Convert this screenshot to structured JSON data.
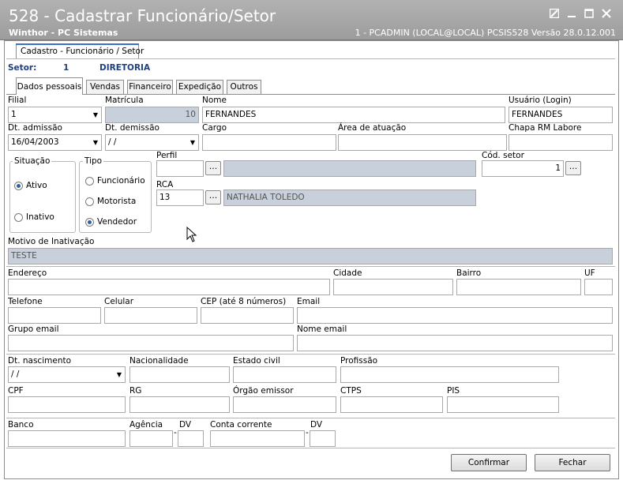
{
  "window": {
    "title": "528 - Cadastrar Funcionário/Setor",
    "company": "Winthor - PC Sistemas",
    "info": "1 - PCADMIN (LOCAL@LOCAL)   PCSIS528  Versão  28.0.12.001",
    "controls": [
      "restore-icon",
      "minimize-icon",
      "maximize-icon",
      "close-icon"
    ]
  },
  "outer_tab": "Cadastro - Funcionário / Setor",
  "setor": {
    "label": "Setor:",
    "code": "1",
    "name": "DIRETORIA"
  },
  "tabs": [
    "Dados pessoais",
    "Vendas",
    "Financeiro",
    "Expedição",
    "Outros"
  ],
  "fields": {
    "filial": {
      "label": "Filial",
      "value": "1"
    },
    "matricula": {
      "label": "Matrícula",
      "value": "10"
    },
    "nome": {
      "label": "Nome",
      "value": "FERNANDES"
    },
    "usuario": {
      "label": "Usuário (Login)",
      "value": "FERNANDES"
    },
    "dt_admissao": {
      "label": "Dt. admissão",
      "value": "16/04/2003"
    },
    "dt_demissao": {
      "label": "Dt.  demissão",
      "value": " / /"
    },
    "cargo": {
      "label": "Cargo",
      "value": ""
    },
    "area": {
      "label": "Área de atuação",
      "value": ""
    },
    "chapa": {
      "label": "Chapa RM Labore",
      "value": ""
    },
    "perfil": {
      "label": "Perfil",
      "value": ""
    },
    "cod_setor": {
      "label": "Cód. setor",
      "value": "1"
    },
    "rca": {
      "label": "RCA",
      "value": "13",
      "desc": "NATHALIA TOLEDO"
    },
    "motivo": {
      "label": "Motivo de Inativação",
      "value": "TESTE"
    },
    "endereco": {
      "label": "Endereço"
    },
    "cidade": {
      "label": "Cidade"
    },
    "bairro": {
      "label": "Bairro"
    },
    "uf": {
      "label": "UF"
    },
    "telefone": {
      "label": "Telefone"
    },
    "celular": {
      "label": "Celular"
    },
    "cep": {
      "label": "CEP (até 8 números)"
    },
    "email": {
      "label": "Email"
    },
    "grupo_email": {
      "label": "Grupo email"
    },
    "nome_email": {
      "label": "Nome email"
    },
    "dt_nascimento": {
      "label": "Dt. nascimento",
      "value": " / /"
    },
    "nacionalidade": {
      "label": "Nacionalidade"
    },
    "estado_civil": {
      "label": "Estado civil"
    },
    "profissao": {
      "label": "Profissão"
    },
    "cpf": {
      "label": "CPF"
    },
    "rg": {
      "label": "RG"
    },
    "orgao": {
      "label": "Órgão emissor"
    },
    "ctps": {
      "label": "CTPS"
    },
    "pis": {
      "label": "PIS"
    },
    "banco": {
      "label": "Banco"
    },
    "agencia": {
      "label": "Agência"
    },
    "dv1": {
      "label": "DV"
    },
    "conta": {
      "label": "Conta corrente"
    },
    "dv2": {
      "label": "DV"
    }
  },
  "situacao": {
    "label": "Situação",
    "options": [
      "Ativo",
      "Inativo"
    ],
    "selected": "Ativo"
  },
  "tipo": {
    "label": "Tipo",
    "options": [
      "Funcionário",
      "Motorista",
      "Vendedor"
    ],
    "selected": "Vendedor"
  },
  "dots_label": "...",
  "dropdown_arrow": "▼",
  "buttons": {
    "confirmar": "Confirmar",
    "fechar": "Fechar"
  }
}
